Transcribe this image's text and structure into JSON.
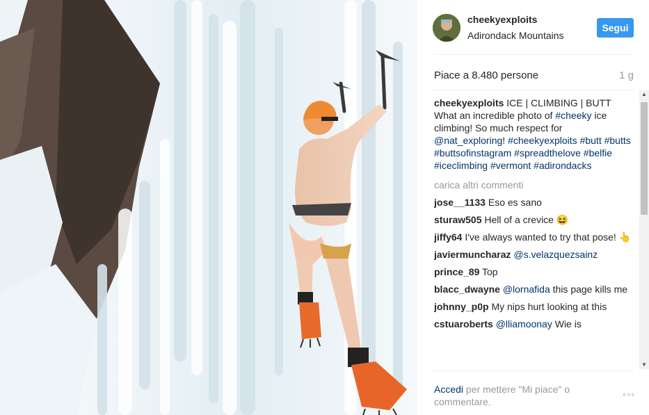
{
  "header": {
    "username": "cheekyexploits",
    "location": "Adirondack Mountains",
    "follow_label": "Segui"
  },
  "meta": {
    "likes": "Piace a 8.480 persone",
    "time": "1 g"
  },
  "caption": {
    "user": "cheekyexploits",
    "text_1": "ICE | CLIMBING | BUTT What an incredible photo of ",
    "tag_1": "#cheeky",
    "text_2": " ice climbing! So much respect for ",
    "tag_2": "@nat_exploring",
    "text_3": "! ",
    "tags": "#cheekyexploits #butt #butts #buttsofinstagram #spreadthelove #belfie #iceclimbing #vermont #adirondacks"
  },
  "load_more": "carica altri commenti",
  "comments": [
    {
      "user": "jose__1133",
      "text": "Eso es sano",
      "mention": ""
    },
    {
      "user": "sturaw505",
      "text": "Hell of a crevice 😆",
      "mention": ""
    },
    {
      "user": "jiffy64",
      "text": "I've always wanted to try that pose! 👆",
      "mention": ""
    },
    {
      "user": "javiermuncharaz",
      "text": "",
      "mention": "@s.velazquezsainz"
    },
    {
      "user": "prince_89",
      "text": "Top",
      "mention": ""
    },
    {
      "user": "blacc_dwayne",
      "text": " this page kills me",
      "mention": "@lornafida"
    },
    {
      "user": "johnny_p0p",
      "text": "My nips hurt looking at this",
      "mention": ""
    },
    {
      "user": "cstuaroberts",
      "text": " Wie is",
      "mention": "@lliamoonay"
    }
  ],
  "footer": {
    "login_label": "Accedi",
    "rest": " per mettere \"Mi piace\" o commentare.",
    "more_icon": "◦◦◦"
  },
  "icons": {
    "scroll_up": "▲",
    "scroll_down": "▼"
  },
  "colors": {
    "follow_button": "#3897f0",
    "link": "#003569",
    "muted": "#999999"
  }
}
